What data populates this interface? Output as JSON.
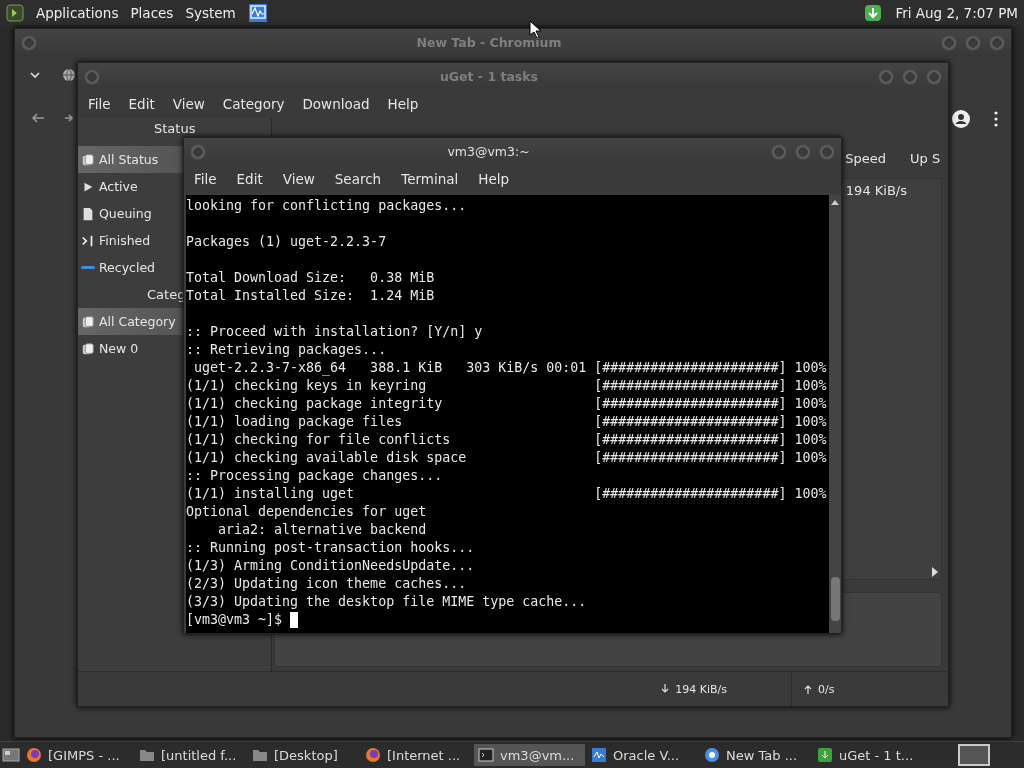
{
  "top_panel": {
    "menus": [
      "Applications",
      "Places",
      "System"
    ],
    "clock": "Fri Aug  2,  7:07 PM"
  },
  "chromium": {
    "title": "New Tab - Chromium"
  },
  "uget": {
    "title": "uGet - 1 tasks",
    "menu": [
      "File",
      "Edit",
      "View",
      "Category",
      "Download",
      "Help"
    ],
    "status_header": "Status",
    "status_items": [
      {
        "label": "All Status",
        "kind": "all",
        "selected": true
      },
      {
        "label": "Active",
        "kind": "active",
        "selected": false
      },
      {
        "label": "Queuing",
        "kind": "queuing",
        "selected": false
      },
      {
        "label": "Finished",
        "kind": "finished",
        "selected": false
      },
      {
        "label": "Recycled",
        "kind": "recycled",
        "selected": false
      }
    ],
    "category_header": "Categ",
    "category_items": [
      {
        "label": "All Category",
        "selected": true
      },
      {
        "label": "New 0",
        "selected": false
      }
    ],
    "columns": [
      "Speed",
      "Up S"
    ],
    "row_speed": "194 KiB/s",
    "down_speed": "194 KiB/s",
    "up_speed": "0/s"
  },
  "terminal": {
    "title": "vm3@vm3:~",
    "menu": [
      "File",
      "Edit",
      "View",
      "Search",
      "Terminal",
      "Help"
    ],
    "blocks": [
      [
        {
          "text": "looking for conflicting packages..."
        }
      ],
      [
        {
          "text": "Packages (1) uget-2.2.3-7"
        }
      ],
      [
        {
          "text": "Total Download Size:   0.38 MiB"
        },
        {
          "text": "Total Installed Size:  1.24 MiB"
        }
      ],
      [
        {
          "text": ":: Proceed with installation? [Y/n] y"
        },
        {
          "text": ":: Retrieving packages..."
        },
        {
          "text": " uget-2.2.3-7-x86_64   388.1 KiB   303 KiB/s 00:01",
          "progress": "[######################] 100%"
        },
        {
          "text": "(1/1) checking keys in keyring",
          "progress": "[######################] 100%"
        },
        {
          "text": "(1/1) checking package integrity",
          "progress": "[######################] 100%"
        },
        {
          "text": "(1/1) loading package files",
          "progress": "[######################] 100%"
        },
        {
          "text": "(1/1) checking for file conflicts",
          "progress": "[######################] 100%"
        },
        {
          "text": "(1/1) checking available disk space",
          "progress": "[######################] 100%"
        },
        {
          "text": ":: Processing package changes..."
        },
        {
          "text": "(1/1) installing uget",
          "progress": "[######################] 100%"
        },
        {
          "text": "Optional dependencies for uget"
        },
        {
          "text": "    aria2: alternative backend"
        },
        {
          "text": ":: Running post-transaction hooks..."
        },
        {
          "text": "(1/3) Arming ConditionNeedsUpdate..."
        },
        {
          "text": "(2/3) Updating icon theme caches..."
        },
        {
          "text": "(3/3) Updating the desktop file MIME type cache..."
        }
      ]
    ],
    "prompt": "[vm3@vm3 ~]$"
  },
  "taskbar": [
    {
      "label": "[GIMPS - ...",
      "kind": "browser",
      "selected": false
    },
    {
      "label": "[untitled f...",
      "kind": "folder",
      "selected": false
    },
    {
      "label": "[Desktop]",
      "kind": "folder",
      "selected": false
    },
    {
      "label": "[Internet ...",
      "kind": "browser",
      "selected": false
    },
    {
      "label": "vm3@vm...",
      "kind": "terminal",
      "selected": true
    },
    {
      "label": "Oracle V...",
      "kind": "monitor",
      "selected": false
    },
    {
      "label": "New Tab ...",
      "kind": "chrome",
      "selected": false
    },
    {
      "label": "uGet - 1 t...",
      "kind": "downloader",
      "selected": false
    }
  ]
}
